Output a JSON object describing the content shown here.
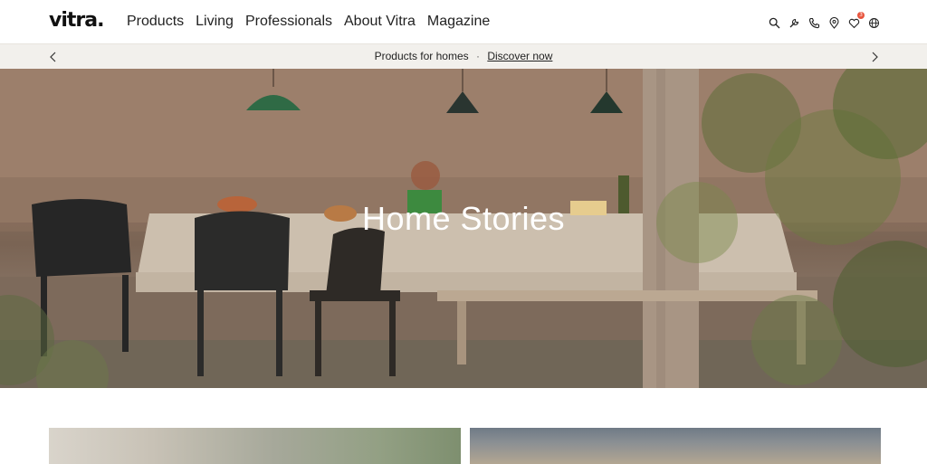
{
  "header": {
    "logo": "vitra.",
    "nav": [
      "Products",
      "Living",
      "Professionals",
      "About Vitra",
      "Magazine"
    ],
    "icons": [
      "search-icon",
      "wrench-icon",
      "phone-icon",
      "location-pin-icon",
      "heart-icon",
      "globe-icon"
    ],
    "wishlist_count": "3"
  },
  "promo": {
    "text": "Products for homes",
    "separator": "·",
    "link": "Discover now"
  },
  "hero": {
    "title": "Home Stories"
  },
  "colors": {
    "promo_bg": "#f2f0ec",
    "badge": "#e8553e"
  }
}
